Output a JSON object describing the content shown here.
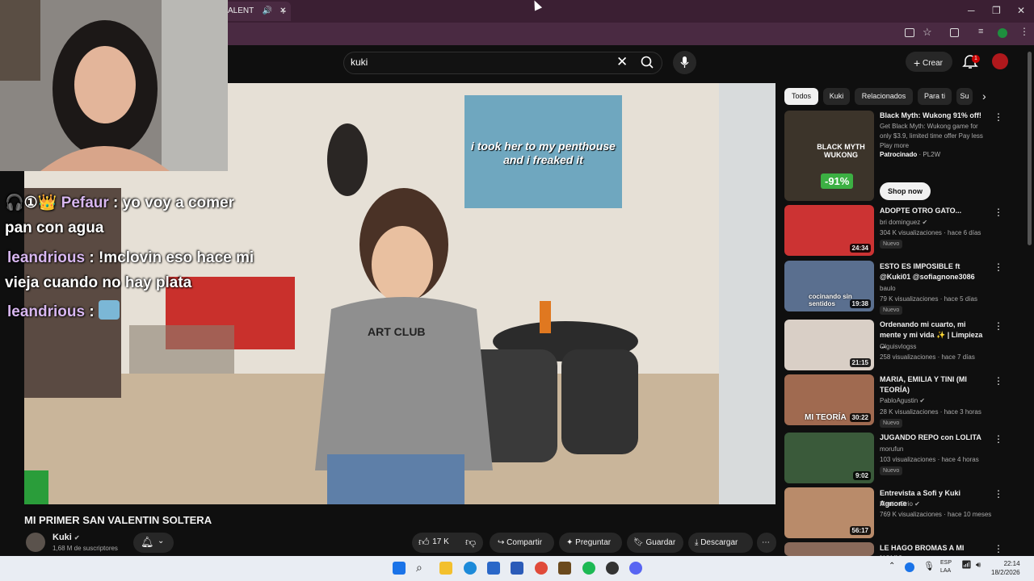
{
  "browser": {
    "tab_title": "ALENT",
    "new_tab": "+",
    "win_min": "─",
    "win_max": "❐",
    "win_close": "✕"
  },
  "header": {
    "search_value": "kuki",
    "create_label": "Crear",
    "notif_count": "1"
  },
  "overlay_chat": [
    {
      "user": "Pefaur",
      "sep": " : ",
      "msg": "yo voy a comer",
      "msg2": "pan con agua"
    },
    {
      "user": "leandrious",
      "sep": " : ",
      "msg": "!mclovin eso hace mi",
      "msg2": "vieja cuando no hay plata"
    },
    {
      "user": "leandrious",
      "sep": " : ",
      "msg": "",
      "msg2": ""
    }
  ],
  "poster_text": "i took her to my penthouse and i freaked it",
  "shirt_text": "ART CLUB",
  "video": {
    "title": "MI PRIMER SAN VALENTIN SOLTERA",
    "channel": "Kuki",
    "subs": "1,68 M de suscriptores",
    "likes": "17 K",
    "share": "Compartir",
    "ask": "Preguntar",
    "save": "Guardar",
    "download": "Descargar"
  },
  "chips": [
    "Todos",
    "Kuki",
    "Relacionados",
    "Para ti",
    "Su"
  ],
  "ad": {
    "title": "Black Myth: Wukong 91% off!",
    "desc": "Get Black Myth: Wukong game for only $3.9, limited time offer Pay less Play more",
    "sponsored": "Patrocinado",
    "advertiser": "· PL2W",
    "cta": "Shop now",
    "thumb_title": "BLACK MYTH WUKONG",
    "badge": "-91%"
  },
  "videos": [
    {
      "title": "ADOPTE OTRO GATO...",
      "channel": "bri dominguez",
      "verified": true,
      "meta": "304 K visualizaciones · hace 6 días",
      "duration": "24:34",
      "nuevo": "Nuevo"
    },
    {
      "title": "ESTO ES IMPOSIBLE ft @Kuki01 @sofiagnone3086",
      "channel": "baulo",
      "verified": false,
      "meta": "79 K visualizaciones · hace 5 días",
      "duration": "19:38",
      "nuevo": "Nuevo",
      "thumb_text": "cocinando sin sentidos"
    },
    {
      "title": "Ordenando mi cuarto, mi mente y mi vida ✨ | Limpieza ...",
      "channel": "Olguisvlogss",
      "verified": false,
      "meta": "258 visualizaciones · hace 7 días",
      "duration": "21:15",
      "nuevo": ""
    },
    {
      "title": "MARIA, EMILIA Y TINI (MI TEORÍA)",
      "channel": "PabloAgustin",
      "verified": true,
      "meta": "28 K visualizaciones · hace 3 horas",
      "duration": "30:22",
      "nuevo": "Nuevo",
      "thumb_text": "MI TEORÍA"
    },
    {
      "title": "JUGANDO REPO con LOLITA",
      "channel": "morufun",
      "verified": false,
      "meta": "103 visualizaciones · hace 4 horas",
      "duration": "9:02",
      "nuevo": "Nuevo"
    },
    {
      "title": "Entrevista a Sofi y Kuki Agnone",
      "channel": "Martin Cirio",
      "verified": true,
      "meta": "769 K visualizaciones · hace 10 meses",
      "duration": "56:17",
      "nuevo": ""
    },
    {
      "title": "LE HAGO BROMAS A MI NOVIO",
      "channel": "",
      "verified": false,
      "meta": "",
      "duration": "",
      "nuevo": ""
    }
  ],
  "taskbar": {
    "lang": "ESP",
    "lang2": "LAA",
    "time": "22:14",
    "date": "18/2/2026"
  },
  "colors": {
    "accent": "#cc0000",
    "chip_active": "#f1f1f1",
    "chrome": "#4a2a42"
  }
}
